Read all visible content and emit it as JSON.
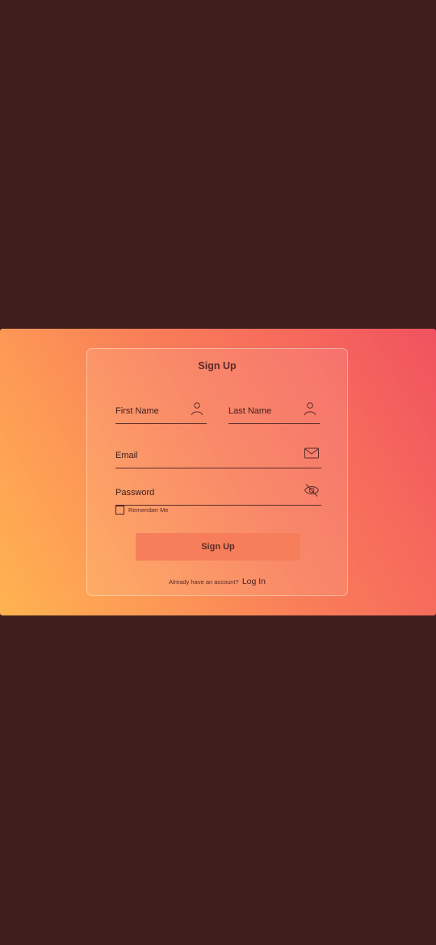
{
  "colors": {
    "background": "#3e1e1d",
    "gradient_start": "#ffb350",
    "gradient_end": "#f0525f",
    "button": "#f77e5a",
    "text_dark": "#5a2b27"
  },
  "form": {
    "title": "Sign Up",
    "first_name": {
      "placeholder": "First Name",
      "icon": "user-icon"
    },
    "last_name": {
      "placeholder": "Last Name",
      "icon": "user-icon"
    },
    "email": {
      "placeholder": "Email",
      "icon": "envelope-icon"
    },
    "password": {
      "placeholder": "Password",
      "icon": "eye-off-icon"
    },
    "remember_label": "Remember Me",
    "remember_checked": false,
    "submit_label": "Sign Up",
    "footer_text": "Already have an account?",
    "login_link": "Log In"
  }
}
